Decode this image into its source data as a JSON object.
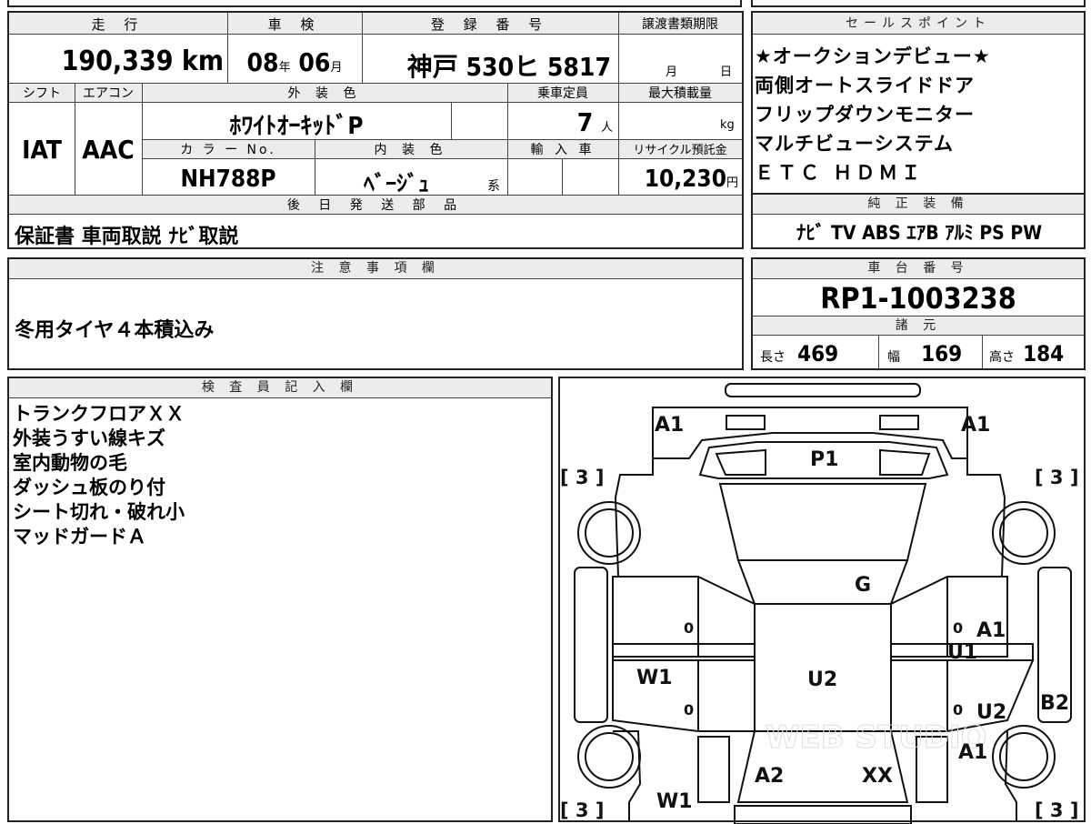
{
  "main_info": {
    "mileage_label": "走 行",
    "mileage_value": "190,339",
    "mileage_unit": "km",
    "inspection_label": "車 検",
    "inspection_year": "08",
    "inspection_year_unit": "年",
    "inspection_month": "06",
    "inspection_month_unit": "月",
    "registration_label": "登 録 番 号",
    "registration_value": "神戸 530ヒ 5817",
    "transfer_label": "譲渡書類期限",
    "transfer_month_unit": "月",
    "transfer_day_unit": "日",
    "shift_label": "シフト",
    "shift_value": "IAT",
    "ac_label": "エアコン",
    "ac_value": "AAC",
    "ext_color_label": "外 装 色",
    "ext_color_value": "ﾎﾜｲﾄｵｰｷｯﾄﾞP",
    "capacity_label": "乗車定員",
    "capacity_value": "7",
    "capacity_unit": "人",
    "max_load_label": "最大積載量",
    "max_load_unit": "kg",
    "color_no_label": "カ ラ ー No.",
    "color_no_value": "NH788P",
    "int_color_label": "内 装 色",
    "int_color_value": "ﾍﾞｰｼﾞｭ",
    "int_color_suffix": "系",
    "import_label": "輸 入 車",
    "recycle_label": "リサイクル預託金",
    "recycle_value": "10,230",
    "recycle_unit": "円",
    "later_parts_label": "後 日 発 送 部 品",
    "later_parts_value": "保証書 車両取説 ﾅﾋﾞ取説"
  },
  "sales_points": {
    "label": "セールスポイント",
    "lines": [
      "★オークションデビュー★",
      "両側オートスライドドア",
      "フリップダウンモニター",
      "マルチビューシステム",
      "ＥＴＣ ＨＤＭＩ"
    ]
  },
  "genuine_equipment": {
    "label": "純 正 装 備",
    "value": "ﾅﾋﾞ TV ABS ｴｱB ｱﾙﾐ PS PW"
  },
  "notes": {
    "label": "注 意 事 項 欄",
    "value": "冬用タイヤ４本積込み"
  },
  "chassis": {
    "label": "車 台 番 号",
    "value": "RP1-1003238",
    "spec_label": "諸 元",
    "length_label": "長さ",
    "length_value": "469",
    "width_label": "幅",
    "width_value": "169",
    "height_label": "高さ",
    "height_value": "184"
  },
  "inspector": {
    "label": "検 査 員 記 入 欄",
    "lines": [
      "トランクフロアＸＸ",
      "外装うすい線キズ",
      "室内動物の毛",
      "ダッシュ板のり付",
      "シート切れ・破れ小",
      "マッドガードＡ"
    ]
  },
  "diagram": {
    "marks": {
      "a1_front_left": "A1",
      "a1_front_right": "A1",
      "p1": "P1",
      "g": "G",
      "u2_center": "U2",
      "w1_left_door": "W1",
      "a1_right_door": "A1",
      "u1_right": "U1",
      "b2": "B2",
      "u2_right": "U2",
      "a1_right_rear": "A1",
      "a2": "A2",
      "xx": "XX",
      "w1_rear_left": "W1",
      "tire_fl": "[ 3 ]",
      "tire_fr": "[ 3 ]",
      "tire_rl": "[ 3 ]",
      "tire_rr": "[ 3 ]",
      "zero_1": "0",
      "zero_2": "0",
      "zero_3": "0",
      "zero_4": "0"
    },
    "watermark": "WEB STUDIO"
  }
}
